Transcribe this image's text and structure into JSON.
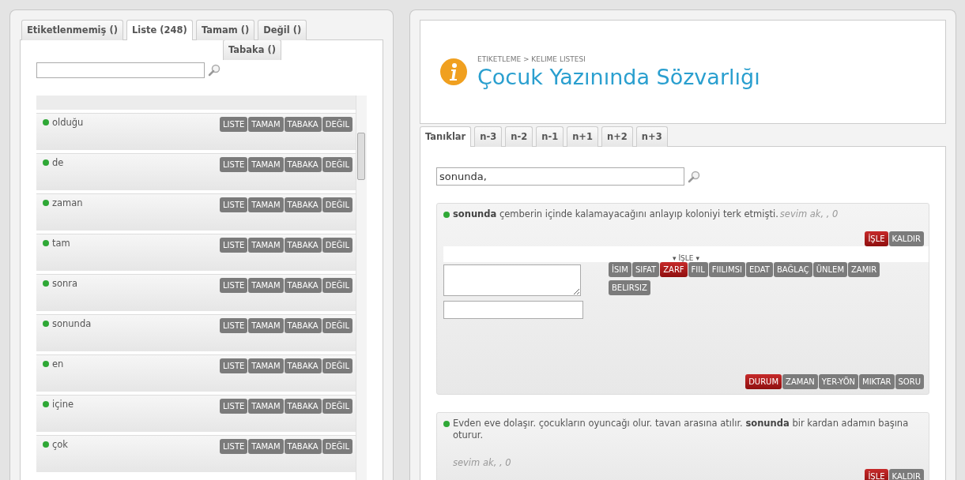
{
  "left_panel": {
    "tabs": [
      {
        "label": "Etiketlenmemiş ()",
        "selected": false
      },
      {
        "label": "Liste (248)",
        "selected": true
      },
      {
        "label": "Tamam ()",
        "selected": false
      },
      {
        "label": "Değil ()",
        "selected": false
      }
    ],
    "sub_tabs": [
      {
        "label": "Tabaka ()",
        "selected": false
      }
    ],
    "words": [
      {
        "word": "olduğu",
        "color": "#2fa836",
        "actions": [
          "LISTE",
          "TAMAM",
          "TABAKA",
          "DEĞIL"
        ]
      },
      {
        "word": "de",
        "color": "#2fa836",
        "actions": [
          "LISTE",
          "TAMAM",
          "TABAKA",
          "DEĞIL"
        ]
      },
      {
        "word": "zaman",
        "color": "#2fa836",
        "actions": [
          "LISTE",
          "TAMAM",
          "TABAKA",
          "DEĞIL"
        ]
      },
      {
        "word": "tam",
        "color": "#2fa836",
        "actions": [
          "LISTE",
          "TAMAM",
          "TABAKA",
          "DEĞIL"
        ]
      },
      {
        "word": "sonra",
        "color": "#2fa836",
        "actions": [
          "LISTE",
          "TAMAM",
          "TABAKA",
          "DEĞIL"
        ]
      },
      {
        "word": "sonunda",
        "color": "#2fa836",
        "actions": [
          "LISTE",
          "TAMAM",
          "TABAKA",
          "DEĞIL"
        ]
      },
      {
        "word": "en",
        "color": "#2fa836",
        "actions": [
          "LISTE",
          "TAMAM",
          "TABAKA",
          "DEĞIL"
        ]
      },
      {
        "word": "içine",
        "color": "#2fa836",
        "actions": [
          "LISTE",
          "TAMAM",
          "TABAKA",
          "DEĞIL"
        ]
      },
      {
        "word": "çok",
        "color": "#2fa836",
        "actions": [
          "LISTE",
          "TAMAM",
          "TABAKA",
          "DEĞIL"
        ]
      }
    ]
  },
  "header": {
    "breadcrumb": "ETIKETLEME > KELIME LISTESI",
    "title": "Çocuk Yazınında Sözvarlığı"
  },
  "right_panel": {
    "tabs": [
      {
        "label": "Tanıklar",
        "selected": true
      },
      {
        "label": "n-3",
        "selected": false
      },
      {
        "label": "n-2",
        "selected": false
      },
      {
        "label": "n-1",
        "selected": false
      },
      {
        "label": "n+1",
        "selected": false
      },
      {
        "label": "n+2",
        "selected": false
      },
      {
        "label": "n+3",
        "selected": false
      }
    ],
    "search": {
      "value": "sonunda,"
    },
    "examples": [
      {
        "sentence": "**sonunda** çemberin içinde kalamayacağını anlayıp koloniyi terk etmişti.",
        "meta": "sevim ak, , 0",
        "meta_below": false,
        "process_label": "İŞLE",
        "remove_label": "KALDIR",
        "expanded": true,
        "editor": {
          "toggle": "▾ İŞLE ▾",
          "pos": [
            {
              "label": "İSIM",
              "selected": false
            },
            {
              "label": "SIFAT",
              "selected": false
            },
            {
              "label": "ZARF",
              "selected": true
            },
            {
              "label": "FIIL",
              "selected": false
            },
            {
              "label": "FIILIMSI",
              "selected": false
            },
            {
              "label": "EDAT",
              "selected": false
            },
            {
              "label": "BAĞLAÇ",
              "selected": false
            },
            {
              "label": "ÜNLEM",
              "selected": false
            },
            {
              "label": "ZAMIR",
              "selected": false
            },
            {
              "label": "BELIRSIZ",
              "selected": false
            }
          ],
          "subtypes": [
            {
              "label": "DURUM",
              "selected": true
            },
            {
              "label": "ZAMAN",
              "selected": false
            },
            {
              "label": "YER-YÖN",
              "selected": false
            },
            {
              "label": "MIKTAR",
              "selected": false
            },
            {
              "label": "SORU",
              "selected": false
            }
          ]
        }
      },
      {
        "sentence": "Evden eve dolaşır. çocukların oyuncağı olur. tavan arasına atılır. **sonunda** bir kardan adamın başına oturur.",
        "meta": "sevim ak, , 0",
        "meta_below": true,
        "process_label": "İŞLE",
        "remove_label": "KALDIR",
        "expanded": false
      }
    ]
  }
}
